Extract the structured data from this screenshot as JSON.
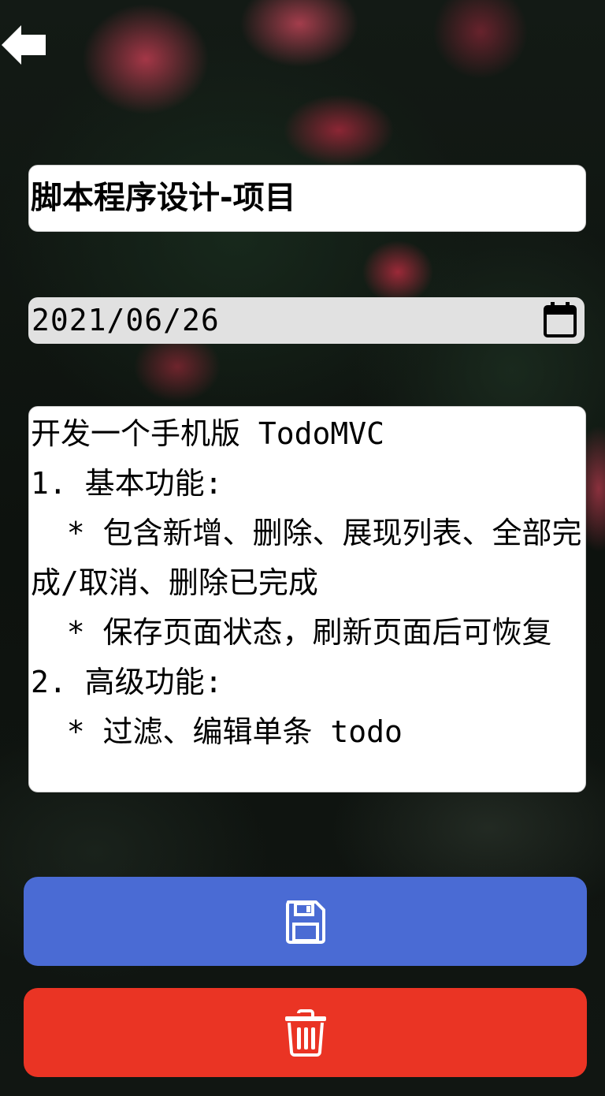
{
  "icons": {
    "back": "arrow-left-icon",
    "calendar": "calendar-icon",
    "save": "floppy-disk-icon",
    "delete": "trash-icon"
  },
  "colors": {
    "save_button": "#4a6bd4",
    "delete_button": "#ea3424",
    "date_field_bg": "#e1e1e1",
    "field_bg": "#ffffff"
  },
  "form": {
    "title_value": "脚本程序设计-项目",
    "date_value": "2021/06/26",
    "content_value": "开发一个手机版 TodoMVC\n1. 基本功能:\n  * 包含新增、删除、展现列表、全部完成/取消、删除已完成\n  * 保存页面状态，刷新页面后可恢复\n2. 高级功能:\n  * 过滤、编辑单条 todo"
  }
}
